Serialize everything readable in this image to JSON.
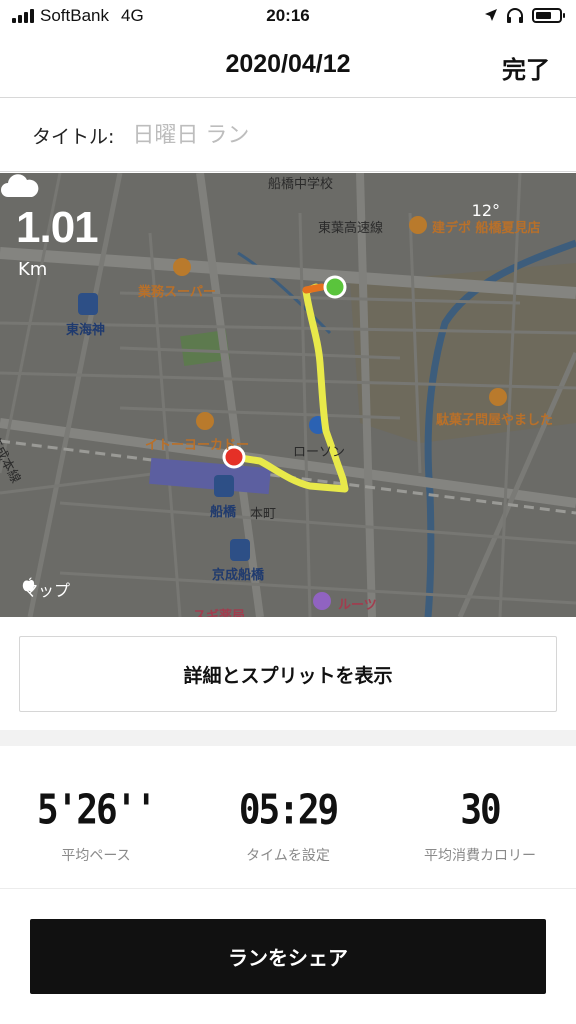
{
  "status_bar": {
    "carrier": "SoftBank",
    "network": "4G",
    "time": "20:16"
  },
  "nav": {
    "title": "2020/04/12",
    "done_label": "完了"
  },
  "title_field": {
    "label": "タイトル:",
    "placeholder": "日曜日 ラン"
  },
  "map": {
    "distance_value": "1.01",
    "distance_unit": "Km",
    "temperature": "12°",
    "weather_icon": "cloud-icon",
    "attribution": "マップ",
    "labels": {
      "school": "船橋中学校",
      "highway": "東葉高速線",
      "store_poi": "建デポ 船橋夏見店",
      "supermarket": "業務スーパー",
      "station_tokaijin": "東海神",
      "keisei_line": "京成本線",
      "ito_yokado": "イトーヨーカドー",
      "lawson": "ローソン",
      "candy_store": "駄菓子問屋やました",
      "station_funabashi": "船橋",
      "honcho": "本町",
      "station_keisei": "京成船橋",
      "sugi": "スギ薬局",
      "roots": "ルーツ"
    },
    "colors": {
      "route": "#e8e94a",
      "start_marker": "#e53027",
      "end_marker": "#5ac43c"
    }
  },
  "detail_button_label": "詳細とスプリットを表示",
  "stats": [
    {
      "value": "5'26''",
      "label": "平均ペース"
    },
    {
      "value": "05:29",
      "label": "タイムを設定"
    },
    {
      "value": "30",
      "label": "平均消費カロリー"
    }
  ],
  "share_button_label": "ランをシェア"
}
